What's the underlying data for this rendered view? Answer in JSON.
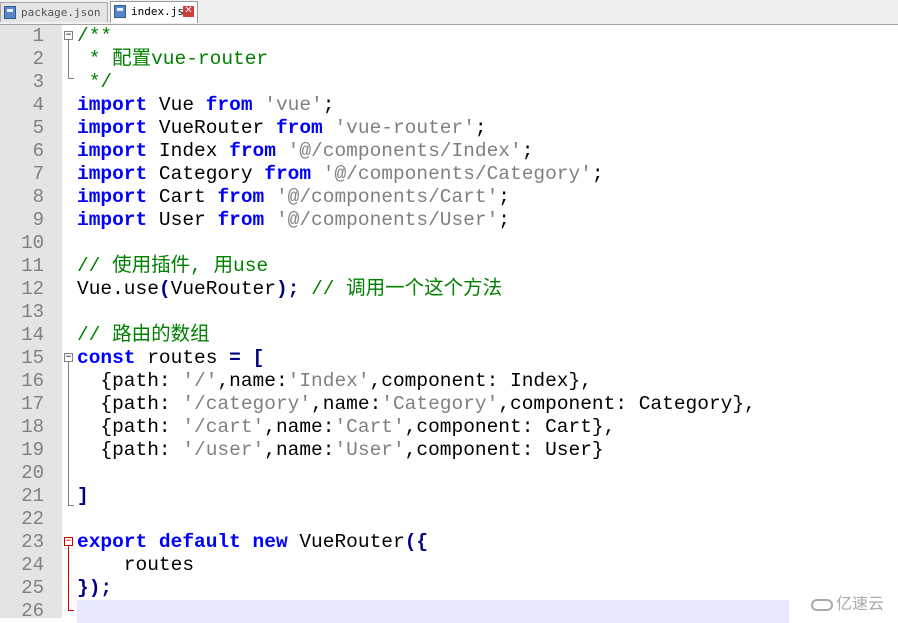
{
  "tabs": [
    {
      "label": "package.json",
      "active": false
    },
    {
      "label": "index.js",
      "active": true
    }
  ],
  "close_glyph": "✕",
  "line_numbers": [
    "1",
    "2",
    "3",
    "4",
    "5",
    "6",
    "7",
    "8",
    "9",
    "10",
    "11",
    "12",
    "13",
    "14",
    "15",
    "16",
    "17",
    "18",
    "19",
    "20",
    "21",
    "22",
    "23",
    "24",
    "25",
    "26"
  ],
  "code_lines": [
    [
      {
        "t": "/**",
        "c": "cm"
      }
    ],
    [
      {
        "t": " * 配置vue-router",
        "c": "cm"
      }
    ],
    [
      {
        "t": " */",
        "c": "cm"
      }
    ],
    [
      {
        "t": "import",
        "c": "kw"
      },
      {
        "t": " Vue ",
        "c": ""
      },
      {
        "t": "from",
        "c": "kw"
      },
      {
        "t": " ",
        "c": ""
      },
      {
        "t": "'vue'",
        "c": "str"
      },
      {
        "t": ";",
        "c": ""
      }
    ],
    [
      {
        "t": "import",
        "c": "kw"
      },
      {
        "t": " VueRouter ",
        "c": ""
      },
      {
        "t": "from",
        "c": "kw"
      },
      {
        "t": " ",
        "c": ""
      },
      {
        "t": "'vue-router'",
        "c": "str"
      },
      {
        "t": ";",
        "c": ""
      }
    ],
    [
      {
        "t": "import",
        "c": "kw"
      },
      {
        "t": " Index ",
        "c": ""
      },
      {
        "t": "from",
        "c": "kw"
      },
      {
        "t": " ",
        "c": ""
      },
      {
        "t": "'@/components/Index'",
        "c": "str"
      },
      {
        "t": ";",
        "c": ""
      }
    ],
    [
      {
        "t": "import",
        "c": "kw"
      },
      {
        "t": " Category ",
        "c": ""
      },
      {
        "t": "from",
        "c": "kw"
      },
      {
        "t": " ",
        "c": ""
      },
      {
        "t": "'@/components/Category'",
        "c": "str"
      },
      {
        "t": ";",
        "c": ""
      }
    ],
    [
      {
        "t": "import",
        "c": "kw"
      },
      {
        "t": " Cart ",
        "c": ""
      },
      {
        "t": "from",
        "c": "kw"
      },
      {
        "t": " ",
        "c": ""
      },
      {
        "t": "'@/components/Cart'",
        "c": "str"
      },
      {
        "t": ";",
        "c": ""
      }
    ],
    [
      {
        "t": "import",
        "c": "kw"
      },
      {
        "t": " User ",
        "c": ""
      },
      {
        "t": "from",
        "c": "kw"
      },
      {
        "t": " ",
        "c": ""
      },
      {
        "t": "'@/components/User'",
        "c": "str"
      },
      {
        "t": ";",
        "c": ""
      }
    ],
    [],
    [
      {
        "t": "// 使用插件, 用use",
        "c": "cm"
      }
    ],
    [
      {
        "t": "Vue.use",
        "c": ""
      },
      {
        "t": "(",
        "c": "op"
      },
      {
        "t": "VueRouter",
        "c": ""
      },
      {
        "t": ");",
        "c": "op"
      },
      {
        "t": " ",
        "c": ""
      },
      {
        "t": "// 调用一个这个方法",
        "c": "cm"
      }
    ],
    [],
    [
      {
        "t": "// 路由的数组",
        "c": "cm"
      }
    ],
    [
      {
        "t": "const",
        "c": "kw"
      },
      {
        "t": " routes ",
        "c": ""
      },
      {
        "t": "=",
        "c": "op"
      },
      {
        "t": " ",
        "c": ""
      },
      {
        "t": "[",
        "c": "op"
      }
    ],
    [
      {
        "t": "  {path: ",
        "c": ""
      },
      {
        "t": "'/'",
        "c": "str"
      },
      {
        "t": ",name:",
        "c": ""
      },
      {
        "t": "'Index'",
        "c": "str"
      },
      {
        "t": ",component: Index},",
        "c": ""
      }
    ],
    [
      {
        "t": "  {path: ",
        "c": ""
      },
      {
        "t": "'/category'",
        "c": "str"
      },
      {
        "t": ",name:",
        "c": ""
      },
      {
        "t": "'Category'",
        "c": "str"
      },
      {
        "t": ",component: Category},",
        "c": ""
      }
    ],
    [
      {
        "t": "  {path: ",
        "c": ""
      },
      {
        "t": "'/cart'",
        "c": "str"
      },
      {
        "t": ",name:",
        "c": ""
      },
      {
        "t": "'Cart'",
        "c": "str"
      },
      {
        "t": ",component: Cart},",
        "c": ""
      }
    ],
    [
      {
        "t": "  {path: ",
        "c": ""
      },
      {
        "t": "'/user'",
        "c": "str"
      },
      {
        "t": ",name:",
        "c": ""
      },
      {
        "t": "'User'",
        "c": "str"
      },
      {
        "t": ",component: User}",
        "c": ""
      }
    ],
    [],
    [
      {
        "t": "]",
        "c": "op"
      }
    ],
    [],
    [
      {
        "t": "export",
        "c": "kw"
      },
      {
        "t": " ",
        "c": ""
      },
      {
        "t": "default",
        "c": "kw"
      },
      {
        "t": " ",
        "c": ""
      },
      {
        "t": "new",
        "c": "kw"
      },
      {
        "t": " VueRouter",
        "c": ""
      },
      {
        "t": "({",
        "c": "op"
      }
    ],
    [
      {
        "t": "    routes",
        "c": ""
      }
    ],
    [
      {
        "t": "});",
        "c": "op"
      }
    ],
    []
  ],
  "current_line": 26,
  "watermark": "亿速云"
}
